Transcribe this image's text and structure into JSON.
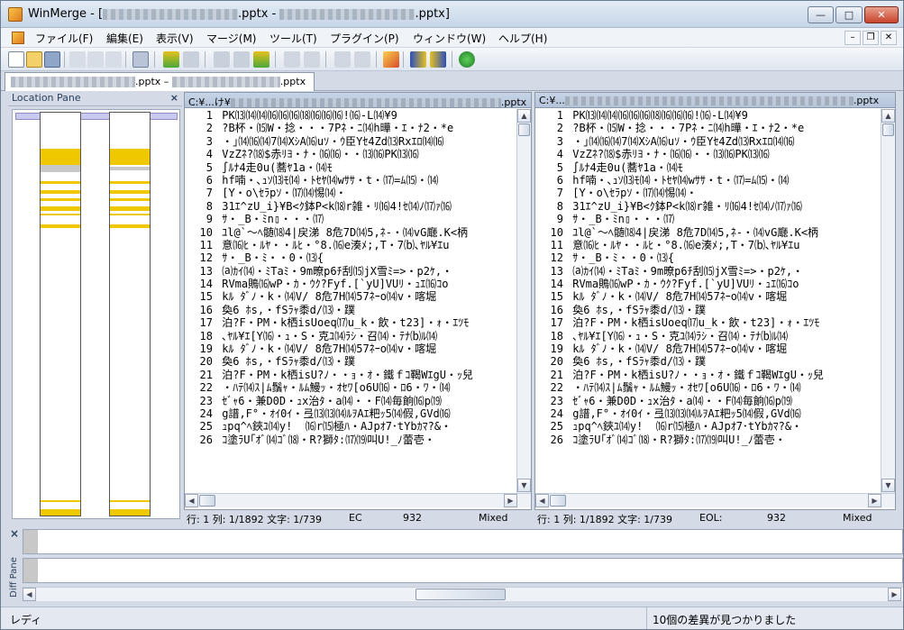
{
  "window": {
    "title_prefix": "WinMerge - [",
    "title_left_file": ".pptx",
    "title_separator": " - ",
    "title_right_file": ".pptx]"
  },
  "menu": [
    "ファイル(F)",
    "編集(E)",
    "表示(V)",
    "マージ(M)",
    "ツール(T)",
    "プラグイン(P)",
    "ウィンドウ(W)",
    "ヘルプ(H)"
  ],
  "doc_tab": {
    "left_ext": ".pptx",
    "separator": " – ",
    "right_ext": ".pptx"
  },
  "location_pane": {
    "title": "Location Pane",
    "close": "×"
  },
  "left_pane": {
    "path_prefix": "C:¥...け¥",
    "path_suffix": ".pptx"
  },
  "right_pane": {
    "path_prefix": "C:¥...",
    "path_suffix": ".pptx"
  },
  "lines": [
    {
      "n": "1",
      "t": "PK⒀⒁⒁⒃⒃⒃⒅⒃⒃⒃!⒃-L⒁¥9"
    },
    {
      "n": "2",
      "t": "?B杯・⒂W・捻・・・7Pﾈ・ﾆ⒁h曄・ｴ・ﾅ2・*e"
    },
    {
      "n": "3",
      "t": "・｣⒁⒃⒁7⒁XｼA⒃uｿ・ｳ臣Yｾ4Zd⒀Rxｴﾛ⒁⒃"
    },
    {
      "n": "4",
      "t": "VzZﾈ?⒅$赤ﾘﾖ・ﾅ・⒃⒃・・⒀⒃PK⒀⒃"
    },
    {
      "n": "5",
      "t": "∫ﾙﾅ4走0u(蕎ﾔ1a・⒁ﾓ"
    },
    {
      "n": "6",
      "t": "hf喃・､ｭｿ⒀ﾓ⒁・ﾄｾﾔ⒁wｻｻ・t・⒄=ﾑ⒂・⒁"
    },
    {
      "n": "7",
      "t": "[Y・o\\ｾﾗpｿ・⒄⒁惕⒁・"
    },
    {
      "n": "8",
      "t": "31ｴ^zU_i}¥B<ｸ鉢P<k⒅r雑・ﾘ⒃4!ｾ⒁ﾉ⒄ｧ⒃"
    },
    {
      "n": "9",
      "t": "ｻ・_B・ﾐn▯・・・⒄"
    },
    {
      "n": "10",
      "t": "ﾕl@`～ﾍ髄⒅4|戻涕 8危7D⒁5,ﾈ-・⒁vG廰.K<柄"
    },
    {
      "n": "11",
      "t": "意⒃ﾋ・ﾙﾔ・・ﾙﾋ・°8.⒃e湊ﾒ;,T・7⒝､ﾔﾙ¥ｴu"
    },
    {
      "n": "12",
      "t": "ｻ・_B・ﾐ・・0・⒀{"
    },
    {
      "n": "13",
      "t": "⒜ｶｲ⒁・ﾐTaﾐ・9m暸p6ﾁ刮⒂jX雪ﾐ=>・p2ｹ,・"
    },
    {
      "n": "14",
      "t": "RVma鵙⒃wP・ｶ・ｳｸ?Fyf.[`yU]VUﾘ・ｭｴ⒃ｺo"
    },
    {
      "n": "15",
      "t": "kﾙ ﾀﾞﾉ・k・⒁V/ 8危7H⒁57ﾈｰo⒁v・喀堀"
    },
    {
      "n": "16",
      "t": "奐6 ﾎs,・fSﾗｬ黍d/⒀・蹼"
    },
    {
      "n": "17",
      "t": "泊?F・PM・k栖isUoeq⒄u_k・飲・t23]・ｫ・ｴﾂﾓ"
    },
    {
      "n": "18",
      "t": "､ﾔﾙ¥ｴ[Y⒃・ｭ・S・克ﾕ⒁ﾗｼ・召⒁・ﾃﾅ⒝ﾙ⒁"
    },
    {
      "n": "19",
      "t": "kﾙ ﾀﾞﾉ・k・⒁V/ 8危7H⒁57ﾈｰo⒁v・喀堀"
    },
    {
      "n": "20",
      "t": "奐6 ﾎs,・fSﾗｬ黍d/⒀・蹼"
    },
    {
      "n": "21",
      "t": "泊?F・PM・k栖isU?ﾉ・・ｮ・ｵ・鐵ｆｺ鞨WｴgU・ｯ兒"
    },
    {
      "n": "22",
      "t": "・ﾊﾃ⒁ｽ|ﾑ鬚ｬ・ﾙﾑ鰻ｯ・ｵｾﾜ[o6U⒃・ﾛ6・ﾜ・⒁"
    },
    {
      "n": "23",
      "t": "ｾﾞｬ6・兼D0D・ｭx治ﾀ・a⒁・・F⒁毎餉⒃p⒆"
    },
    {
      "n": "24",
      "t": "g譜,F°・ｵｲ0ｲ・弖⒀⒀⒁ﾙｦAｴ粑ｯ5⒁假,GVd⒃"
    },
    {
      "n": "25",
      "t": "ｭpq^ﾍ鋏ﾕ⒁y!  ⒃r⒂極ﾊ・AJpｵ7･tYbｶﾏ?&・"
    },
    {
      "n": "26",
      "t": "ｺ塗ﾗU｢ｵﾞ⒁ｺﾞ⒅・R?獅ﾀ:⒄⒆叫U!_ﾉ蕾壱・"
    }
  ],
  "left_status": {
    "pos": "行: 1  列: 1/1892  文字: 1/739",
    "eol": "EC",
    "code": "932",
    "eol_mode": "Mixed"
  },
  "right_status": {
    "pos": "行: 1  列: 1/1892  文字: 1/739",
    "eol": "EOL:",
    "code": "932",
    "eol_mode": "Mixed"
  },
  "diff_pane": {
    "title": "Diff Pane",
    "close": "×"
  },
  "status": {
    "left": "レディ",
    "right": "10個の差異が見つかりました"
  },
  "colors": {
    "diff_yellow": "#f0c800",
    "location_view": "#c8c8f0"
  }
}
